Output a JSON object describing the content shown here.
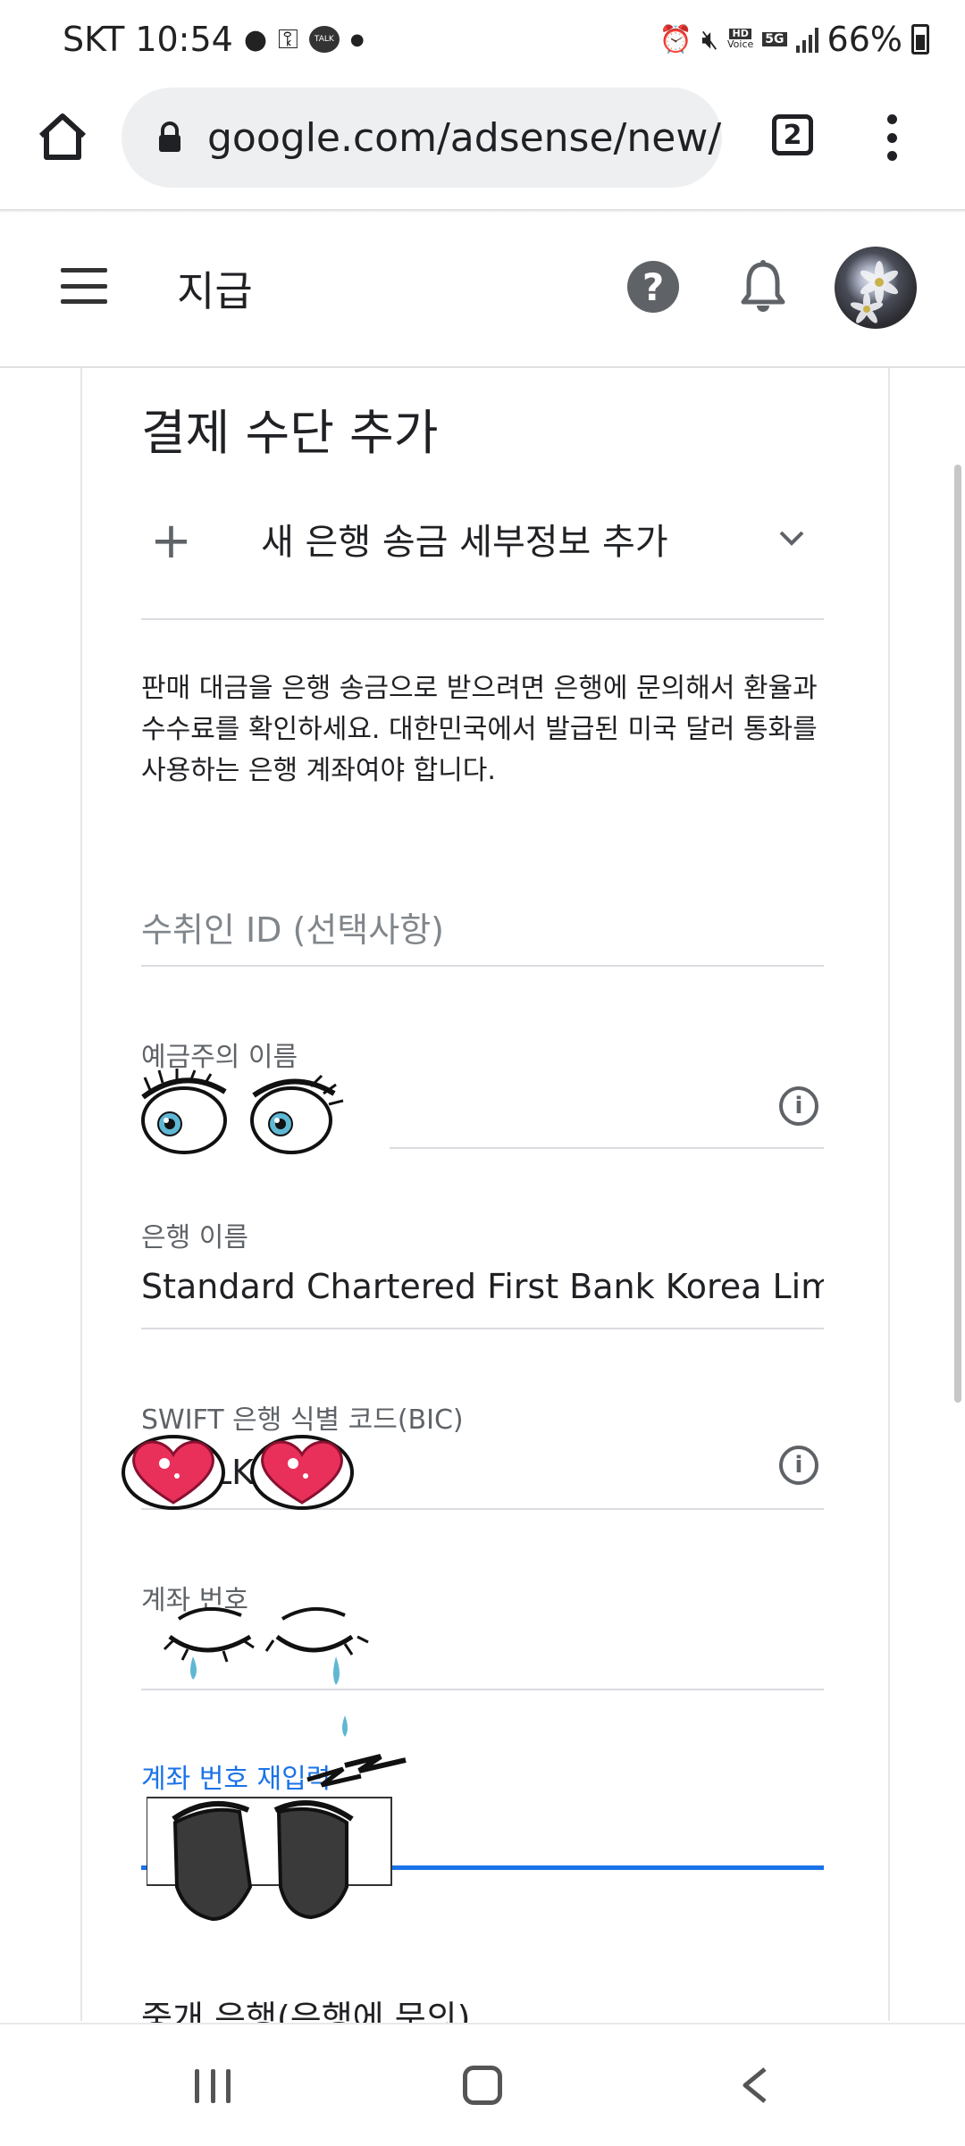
{
  "status_bar": {
    "carrier": "SKT",
    "time": "10:54",
    "talk_badge": "TALK",
    "hd_label": "HD",
    "voice_label": "Voice",
    "net_label": "5G",
    "battery": "66%"
  },
  "browser": {
    "url": "google.com/adsense/new/",
    "tab_count": "2"
  },
  "header": {
    "title": "지급",
    "help_glyph": "?"
  },
  "card": {
    "title": "결제 수단 추가",
    "add_bank_label": "새 은행 송금 세부정보 추가",
    "description": "판매 대금을 은행 송금으로 받으려면 은행에 문의해서 환율과 수수료를 확인하세요. 대한민국에서 발급된 미국 달러 통화를 사용하는 은행 계좌여야 합니다.",
    "fields": {
      "recipient_id_placeholder": "수취인 ID (선택사항)",
      "holder_label": "예금주의 이름",
      "bank_label": "은행 이름",
      "bank_value": "Standard Chartered First Bank Korea Lim",
      "swift_label": "SWIFT 은행 식별 코드(BIC)",
      "swift_value_visible": "LK",
      "account_label": "계좌 번호",
      "account_confirm_label": "계좌 번호 재입력",
      "intermediary_label": "중개 은행(은행에 문의)"
    }
  },
  "colors": {
    "accent": "#1a73e8",
    "text": "#202124",
    "muted": "#5f6368"
  }
}
